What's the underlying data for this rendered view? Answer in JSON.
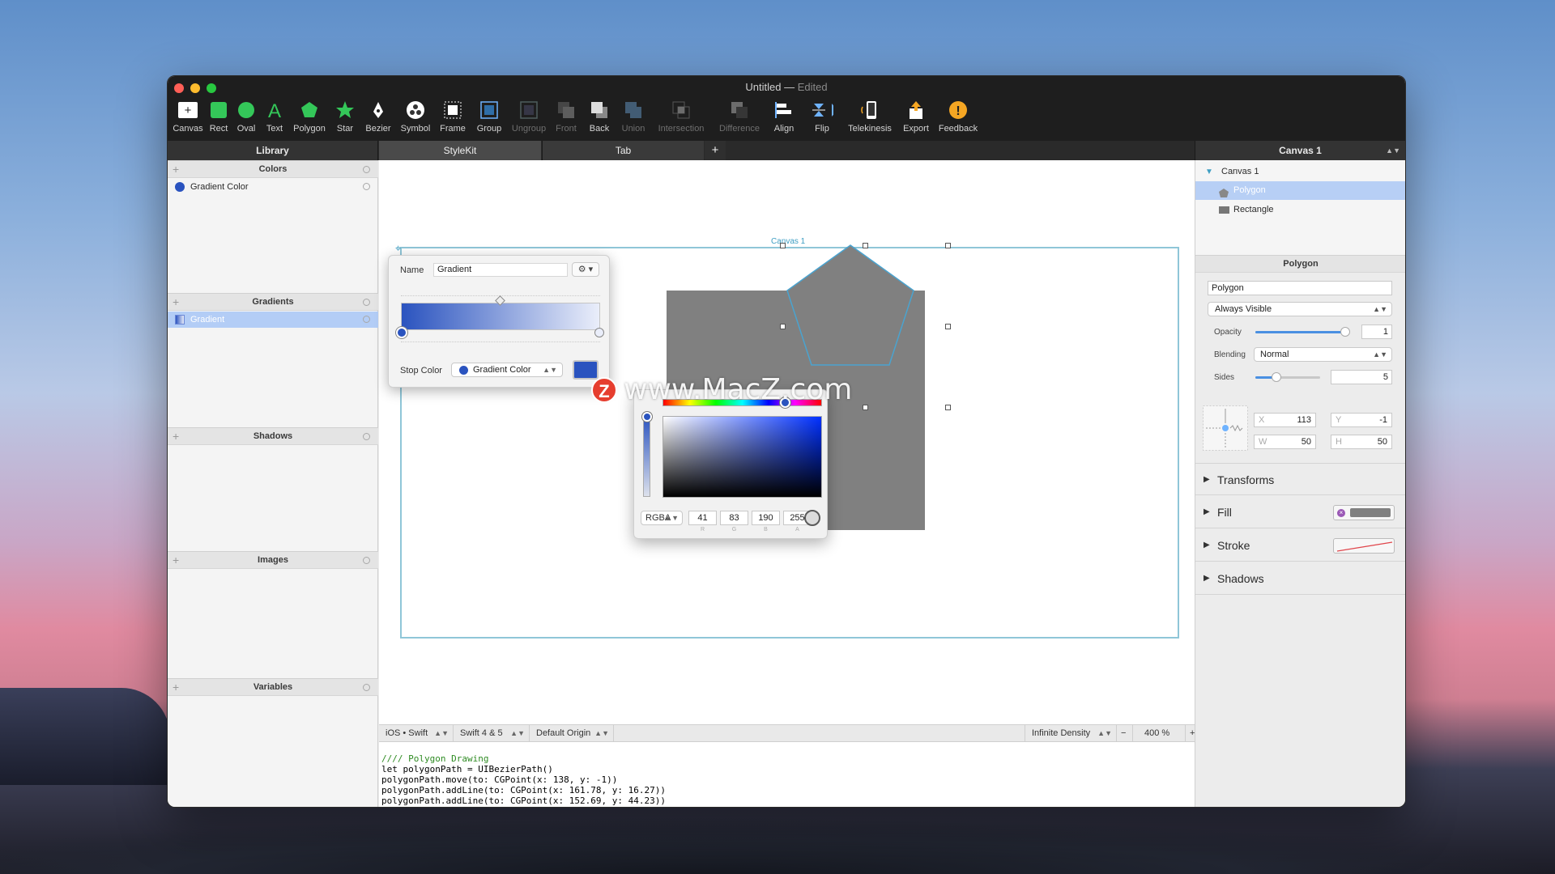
{
  "window": {
    "title": "Untitled",
    "status": "Edited"
  },
  "toolbar": {
    "tools": [
      {
        "label": "Canvas",
        "icon": "canvas-icon",
        "enabled": true
      },
      {
        "label": "Rect",
        "icon": "rect-icon",
        "enabled": true
      },
      {
        "label": "Oval",
        "icon": "oval-icon",
        "enabled": true
      },
      {
        "label": "Text",
        "icon": "text-icon",
        "enabled": true
      },
      {
        "label": "Polygon",
        "icon": "polygon-icon",
        "enabled": true
      },
      {
        "label": "Star",
        "icon": "star-icon",
        "enabled": true
      },
      {
        "label": "Bezier",
        "icon": "bezier-icon",
        "enabled": true
      },
      {
        "label": "Symbol",
        "icon": "symbol-icon",
        "enabled": true
      },
      {
        "label": "Frame",
        "icon": "frame-icon",
        "enabled": true
      },
      {
        "label": "Group",
        "icon": "group-icon",
        "enabled": true
      },
      {
        "label": "Ungroup",
        "icon": "ungroup-icon",
        "enabled": false
      },
      {
        "label": "Front",
        "icon": "front-icon",
        "enabled": false
      },
      {
        "label": "Back",
        "icon": "back-icon",
        "enabled": true
      },
      {
        "label": "Union",
        "icon": "union-icon",
        "enabled": false
      },
      {
        "label": "Intersection",
        "icon": "intersection-icon",
        "enabled": false
      },
      {
        "label": "Difference",
        "icon": "difference-icon",
        "enabled": false
      },
      {
        "label": "Align",
        "icon": "align-icon",
        "enabled": true
      },
      {
        "label": "Flip",
        "icon": "flip-icon",
        "enabled": true
      },
      {
        "label": "Telekinesis",
        "icon": "telekinesis-icon",
        "enabled": true
      },
      {
        "label": "Export",
        "icon": "export-icon",
        "enabled": true
      },
      {
        "label": "Feedback",
        "icon": "feedback-icon",
        "enabled": true
      }
    ]
  },
  "tabs": {
    "library": "Library",
    "stylekit": "StyleKit",
    "tab": "Tab",
    "add": "+",
    "canvas_selector": "Canvas 1"
  },
  "library": {
    "colors": {
      "title": "Colors",
      "items": [
        "Gradient Color"
      ]
    },
    "gradients": {
      "title": "Gradients",
      "items": [
        "Gradient"
      ]
    },
    "shadows": {
      "title": "Shadows"
    },
    "images": {
      "title": "Images"
    },
    "variables": {
      "title": "Variables"
    }
  },
  "canvas": {
    "label": "Canvas 1"
  },
  "gradient_popover": {
    "name_label": "Name",
    "name_value": "Gradient",
    "stop_color_label": "Stop Color",
    "stop_color_value": "Gradient Color"
  },
  "color_picker": {
    "mode": "RGBA",
    "values": [
      "41",
      "83",
      "190",
      "255"
    ],
    "captions": [
      "R",
      "G",
      "B",
      "A"
    ]
  },
  "watermark": {
    "text": "www.MacZ.com",
    "logo": "Z"
  },
  "bottom_bar": {
    "platform": "iOS • Swift",
    "swift_version": "Swift 4 & 5",
    "origin": "Default Origin",
    "density": "Infinite Density",
    "zoom_minus": "−",
    "zoom": "400 %",
    "zoom_plus": "+"
  },
  "code": {
    "lines": [
      "//// Polygon Drawing",
      "let polygonPath = UIBezierPath()",
      "polygonPath.move(to: CGPoint(x: 138, y: -1))",
      "polygonPath.addLine(to: CGPoint(x: 161.78, y: 16.27))",
      "polygonPath.addLine(to: CGPoint(x: 152.69, y: 44.23))"
    ]
  },
  "inspector": {
    "tree": [
      "Canvas 1",
      "Polygon",
      "Rectangle"
    ],
    "section_title": "Polygon",
    "name_value": "Polygon",
    "visibility": "Always Visible",
    "opacity_label": "Opacity",
    "opacity_value": "1",
    "blending_label": "Blending",
    "blending_value": "Normal",
    "sides_label": "Sides",
    "sides_value": "5",
    "x_label": "X",
    "x_value": "113",
    "y_label": "Y",
    "y_value": "-1",
    "w_label": "W",
    "w_value": "50",
    "h_label": "H",
    "h_value": "50",
    "transforms": "Transforms",
    "fill": "Fill",
    "stroke": "Stroke",
    "shadows": "Shadows"
  },
  "colors": {
    "accent": "#2a53bf",
    "shape_gray": "#808080",
    "selection": "#b3cdf6"
  }
}
